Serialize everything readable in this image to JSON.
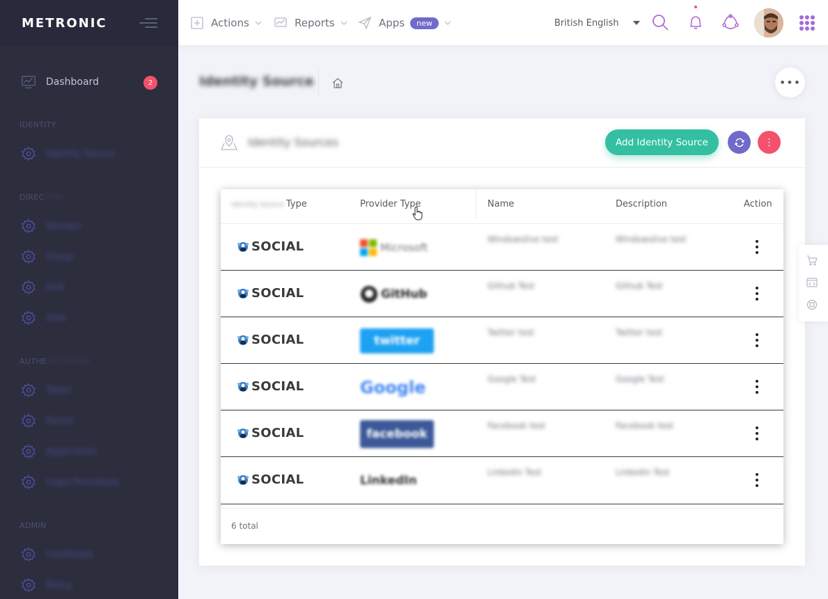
{
  "brand": {
    "name": "METRONIC"
  },
  "sidebar": {
    "dashboard": {
      "label": "Dashboard",
      "badge": "2"
    },
    "sections": [
      {
        "title": "IDENTITY",
        "title_hidden": "",
        "items": [
          "Identity Source"
        ]
      },
      {
        "title": "DIREC",
        "title_hidden": "TORY",
        "items": [
          "Domain",
          "Group",
          "Unit",
          "User"
        ]
      },
      {
        "title": "AUTHE",
        "title_hidden": "NTICATION",
        "items": [
          "Token",
          "Factor",
          "Application",
          "Login Procedure"
        ]
      },
      {
        "title": "ADMIN",
        "title_hidden": "",
        "items": [
          "Certificate",
          "Policy"
        ]
      }
    ]
  },
  "header": {
    "menu": [
      {
        "label": "Actions",
        "icon": "plus-square-icon"
      },
      {
        "label": "Reports",
        "icon": "chart-icon"
      },
      {
        "label": "Apps",
        "icon": "paper-plane-icon",
        "badge": "new"
      }
    ],
    "language": "British English",
    "accent": "#a36bd6"
  },
  "subheader": {
    "title": "Identity Source"
  },
  "portlet": {
    "title": "Identity Sources",
    "add_button": "Add Identity Source",
    "colors": {
      "add": "#34bfa3",
      "refresh": "#716aca",
      "more": "#f4516c"
    }
  },
  "table": {
    "columns": {
      "type_prefix": "Identity Source",
      "type": "Type",
      "provider": "Provider Type",
      "name": "Name",
      "description": "Description",
      "action": "Action"
    },
    "rows": [
      {
        "type": "SOCIAL",
        "provider": "Microsoft",
        "name": "Windowslive test",
        "description": "Windowslive test"
      },
      {
        "type": "SOCIAL",
        "provider": "GitHub",
        "name": "Github Test",
        "description": "Github Test"
      },
      {
        "type": "SOCIAL",
        "provider": "twitter",
        "name": "Twitter test",
        "description": "Twitter test"
      },
      {
        "type": "SOCIAL",
        "provider": "Google",
        "name": "Google Test",
        "description": "Google Test"
      },
      {
        "type": "SOCIAL",
        "provider": "facebook",
        "name": "Facebook test",
        "description": "Facebook test"
      },
      {
        "type": "SOCIAL",
        "provider": "LinkedIn",
        "name": "Linkedin Test",
        "description": "Linkedin Test"
      }
    ],
    "footer": "6 total"
  }
}
